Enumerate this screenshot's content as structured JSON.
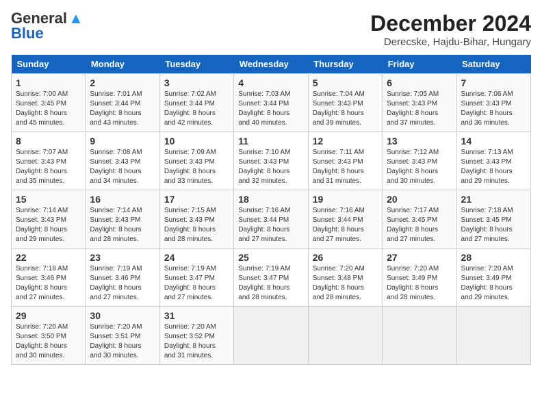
{
  "logo": {
    "part1": "General",
    "part2": "Blue"
  },
  "title": "December 2024",
  "subtitle": "Derecske, Hajdu-Bihar, Hungary",
  "weekdays": [
    "Sunday",
    "Monday",
    "Tuesday",
    "Wednesday",
    "Thursday",
    "Friday",
    "Saturday"
  ],
  "weeks": [
    [
      {
        "day": 1,
        "sunrise": "7:00 AM",
        "sunset": "3:45 PM",
        "daylight": "8 hours and 45 minutes."
      },
      {
        "day": 2,
        "sunrise": "7:01 AM",
        "sunset": "3:44 PM",
        "daylight": "8 hours and 43 minutes."
      },
      {
        "day": 3,
        "sunrise": "7:02 AM",
        "sunset": "3:44 PM",
        "daylight": "8 hours and 42 minutes."
      },
      {
        "day": 4,
        "sunrise": "7:03 AM",
        "sunset": "3:44 PM",
        "daylight": "8 hours and 40 minutes."
      },
      {
        "day": 5,
        "sunrise": "7:04 AM",
        "sunset": "3:43 PM",
        "daylight": "8 hours and 39 minutes."
      },
      {
        "day": 6,
        "sunrise": "7:05 AM",
        "sunset": "3:43 PM",
        "daylight": "8 hours and 37 minutes."
      },
      {
        "day": 7,
        "sunrise": "7:06 AM",
        "sunset": "3:43 PM",
        "daylight": "8 hours and 36 minutes."
      }
    ],
    [
      {
        "day": 8,
        "sunrise": "7:07 AM",
        "sunset": "3:43 PM",
        "daylight": "8 hours and 35 minutes."
      },
      {
        "day": 9,
        "sunrise": "7:08 AM",
        "sunset": "3:43 PM",
        "daylight": "8 hours and 34 minutes."
      },
      {
        "day": 10,
        "sunrise": "7:09 AM",
        "sunset": "3:43 PM",
        "daylight": "8 hours and 33 minutes."
      },
      {
        "day": 11,
        "sunrise": "7:10 AM",
        "sunset": "3:43 PM",
        "daylight": "8 hours and 32 minutes."
      },
      {
        "day": 12,
        "sunrise": "7:11 AM",
        "sunset": "3:43 PM",
        "daylight": "8 hours and 31 minutes."
      },
      {
        "day": 13,
        "sunrise": "7:12 AM",
        "sunset": "3:43 PM",
        "daylight": "8 hours and 30 minutes."
      },
      {
        "day": 14,
        "sunrise": "7:13 AM",
        "sunset": "3:43 PM",
        "daylight": "8 hours and 29 minutes."
      }
    ],
    [
      {
        "day": 15,
        "sunrise": "7:14 AM",
        "sunset": "3:43 PM",
        "daylight": "8 hours and 29 minutes."
      },
      {
        "day": 16,
        "sunrise": "7:14 AM",
        "sunset": "3:43 PM",
        "daylight": "8 hours and 28 minutes."
      },
      {
        "day": 17,
        "sunrise": "7:15 AM",
        "sunset": "3:43 PM",
        "daylight": "8 hours and 28 minutes."
      },
      {
        "day": 18,
        "sunrise": "7:16 AM",
        "sunset": "3:44 PM",
        "daylight": "8 hours and 27 minutes."
      },
      {
        "day": 19,
        "sunrise": "7:16 AM",
        "sunset": "3:44 PM",
        "daylight": "8 hours and 27 minutes."
      },
      {
        "day": 20,
        "sunrise": "7:17 AM",
        "sunset": "3:45 PM",
        "daylight": "8 hours and 27 minutes."
      },
      {
        "day": 21,
        "sunrise": "7:18 AM",
        "sunset": "3:45 PM",
        "daylight": "8 hours and 27 minutes."
      }
    ],
    [
      {
        "day": 22,
        "sunrise": "7:18 AM",
        "sunset": "3:46 PM",
        "daylight": "8 hours and 27 minutes."
      },
      {
        "day": 23,
        "sunrise": "7:19 AM",
        "sunset": "3:46 PM",
        "daylight": "8 hours and 27 minutes."
      },
      {
        "day": 24,
        "sunrise": "7:19 AM",
        "sunset": "3:47 PM",
        "daylight": "8 hours and 27 minutes."
      },
      {
        "day": 25,
        "sunrise": "7:19 AM",
        "sunset": "3:47 PM",
        "daylight": "8 hours and 28 minutes."
      },
      {
        "day": 26,
        "sunrise": "7:20 AM",
        "sunset": "3:48 PM",
        "daylight": "8 hours and 28 minutes."
      },
      {
        "day": 27,
        "sunrise": "7:20 AM",
        "sunset": "3:49 PM",
        "daylight": "8 hours and 28 minutes."
      },
      {
        "day": 28,
        "sunrise": "7:20 AM",
        "sunset": "3:49 PM",
        "daylight": "8 hours and 29 minutes."
      }
    ],
    [
      {
        "day": 29,
        "sunrise": "7:20 AM",
        "sunset": "3:50 PM",
        "daylight": "8 hours and 30 minutes."
      },
      {
        "day": 30,
        "sunrise": "7:20 AM",
        "sunset": "3:51 PM",
        "daylight": "8 hours and 30 minutes."
      },
      {
        "day": 31,
        "sunrise": "7:20 AM",
        "sunset": "3:52 PM",
        "daylight": "8 hours and 31 minutes."
      },
      null,
      null,
      null,
      null
    ]
  ]
}
